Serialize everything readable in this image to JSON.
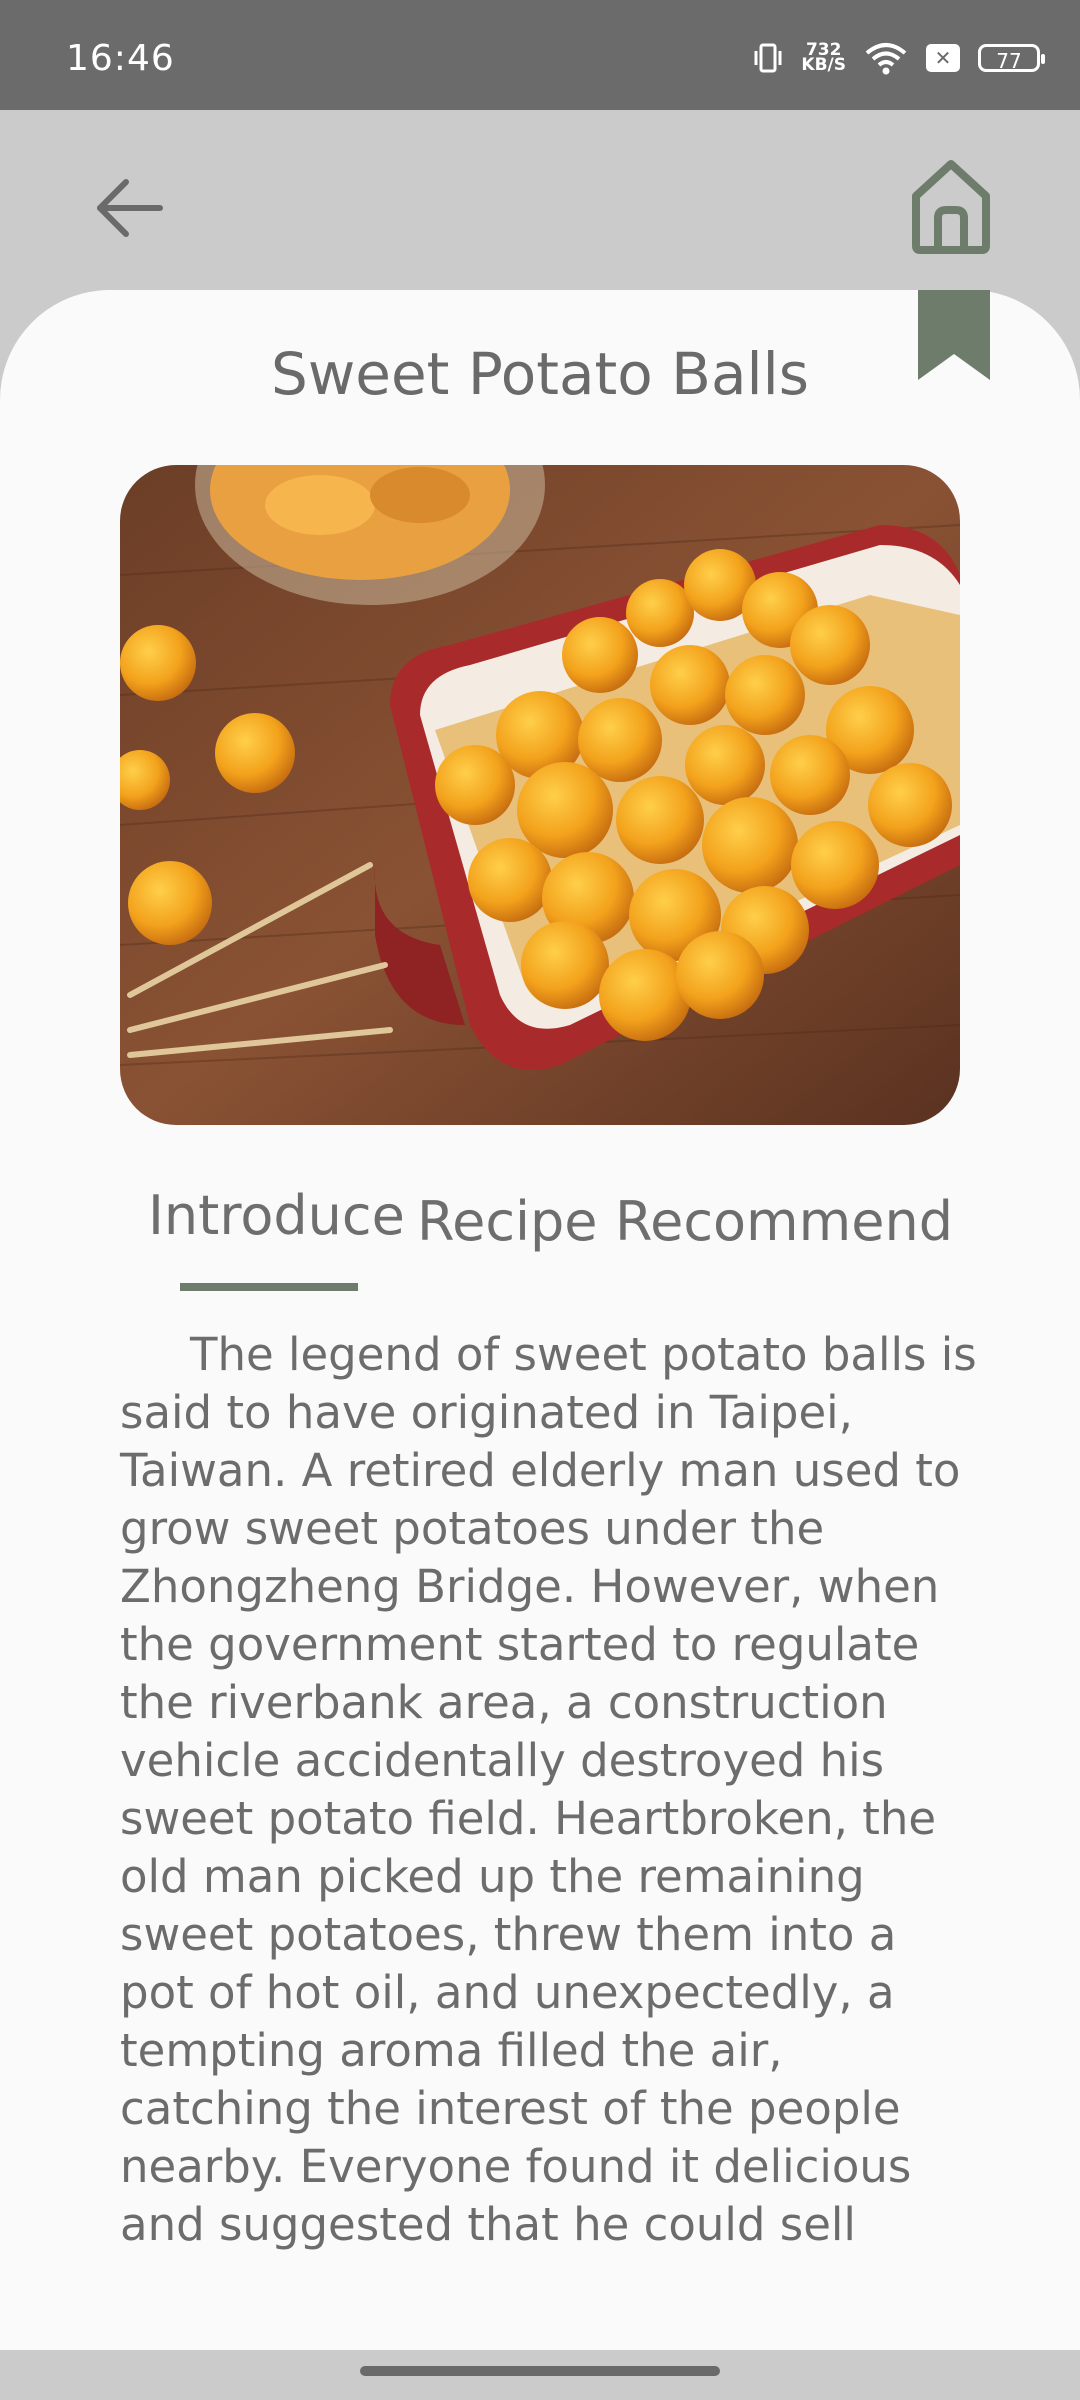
{
  "status_bar": {
    "time": "16:46",
    "net_speed_value": "732",
    "net_speed_unit": "KB/S",
    "battery_level": "77"
  },
  "header": {
    "back_icon": "arrow-left-icon",
    "home_icon": "home-icon"
  },
  "recipe": {
    "title": "Sweet Potato Balls",
    "bookmark_icon": "bookmark-icon",
    "image_alt": "Fried sweet potato balls in a red baking dish"
  },
  "tabs": [
    {
      "label": "Introduce",
      "selected": true
    },
    {
      "label": "Recipe",
      "selected": false
    },
    {
      "label": "Recommend",
      "selected": false
    }
  ],
  "introduction": "The legend of sweet potato balls is said to have originated in Taipei, Taiwan. A retired elderly man used to grow sweet potatoes under the Zhongzheng Bridge. However, when the government started to regulate the riverbank area, a construction vehicle accidentally destroyed his sweet potato field. Heartbroken, the old man picked up the remaining sweet potatoes, threw them into a pot of hot oil, and unexpectedly, a tempting aroma filled the air, catching the interest of the people nearby. Everyone found it delicious and suggested that he could sell",
  "colors": {
    "accent": "#6e7d6b",
    "status_bar": "#6b6b6b",
    "header_bg": "#cbcbcb",
    "card_bg": "#fafafa",
    "text": "#6c6c6c"
  }
}
